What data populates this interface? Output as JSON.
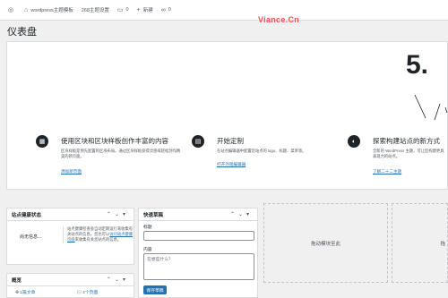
{
  "admin_bar": {
    "site_name": "wordpress主题模板",
    "theme_name": "268主题设置",
    "comments_count": "0",
    "new_label": "新建",
    "links_count": "0"
  },
  "watermark": "Viance.Cn",
  "page": {
    "title": "仪表盘"
  },
  "welcome": {
    "big_number": "5.",
    "columns": [
      {
        "icon": "blocks-icon",
        "title": "使用区块和区块样板创作丰富的内容",
        "desc": "区块样板是预先配置的区块布局。通过区块样板获得灵感或轻松创作精美的新页面。",
        "link": "添加新页面"
      },
      {
        "icon": "layout-icon",
        "title": "开始定制",
        "desc": "在站点编辑器中配置您站点的 logo、标题、菜单等。",
        "link": "打开外观编辑器"
      },
      {
        "icon": "contrast-icon",
        "title": "探索构建站点的新方式",
        "desc": "全新的 WordPress 主题，可让您构建更具表现力的站点。",
        "link": "了解二十二主题"
      }
    ]
  },
  "site_health": {
    "title": "站点健康状态",
    "status": "尚无信息...",
    "desc_pre": "站点健康检查会自动定期运行来收集有关站点的信息。您也可以",
    "desc_link": "访问站点健康页面",
    "desc_post": "来收集有关您站点的信息。"
  },
  "overview": {
    "title": "概览",
    "posts": "1篇文章",
    "pages": "4个页面"
  },
  "quick_draft": {
    "title": "快速草稿",
    "title_label": "标题",
    "content_label": "内容",
    "content_placeholder": "在想些什么？",
    "save_button": "保存草稿"
  },
  "drop_zones": {
    "zone1": "拖动模块至此",
    "zone2": "拖"
  }
}
